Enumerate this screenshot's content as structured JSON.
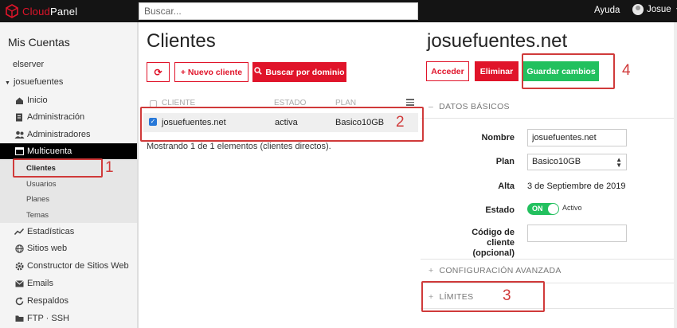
{
  "topbar": {
    "logo_cloud": "Cloud",
    "logo_panel": "Panel",
    "search_placeholder": "Buscar...",
    "help": "Ayuda",
    "user": "Josue"
  },
  "sidebar": {
    "heading": "Mis Cuentas",
    "server": "elserver",
    "account": "josuefuentes",
    "items": [
      {
        "label": "Inicio",
        "icon": "home-icon"
      },
      {
        "label": "Administración",
        "icon": "document-icon"
      },
      {
        "label": "Administradores",
        "icon": "users-icon"
      },
      {
        "label": "Multicuenta",
        "icon": "multiaccount-icon"
      },
      {
        "label": "Estadísticas",
        "icon": "chart-icon"
      },
      {
        "label": "Sitios web",
        "icon": "globe-icon"
      },
      {
        "label": "Constructor de Sitios Web",
        "icon": "gear-icon"
      },
      {
        "label": "Emails",
        "icon": "envelope-icon"
      },
      {
        "label": "Respaldos",
        "icon": "refresh-icon"
      },
      {
        "label": "FTP · SSH",
        "icon": "folder-icon"
      }
    ],
    "subitems": [
      "Clientes",
      "Usuarios",
      "Planes",
      "Temas"
    ]
  },
  "main": {
    "title": "Clientes",
    "buttons": {
      "refresh": "⟳",
      "new_client": "+ Nuevo cliente",
      "search_domain": "Buscar por dominio"
    },
    "table": {
      "headers": [
        "CLIENTE",
        "ESTADO",
        "PLAN"
      ],
      "rows": [
        {
          "client": "josuefuentes.net",
          "status": "activa",
          "plan": "Basico10GB"
        }
      ]
    },
    "showing": "Mostrando 1 de 1 elementos (clientes directos)."
  },
  "detail": {
    "title": "josuefuentes.net",
    "buttons": {
      "access": "Acceder",
      "delete": "Eliminar",
      "save": "Guardar cambios"
    },
    "sections": {
      "basic": "DATOS BÁSICOS",
      "advanced": "CONFIGURACIÓN AVANZADA",
      "limits": "LÍMITES"
    },
    "fields": {
      "name_label": "Nombre",
      "name_value": "josuefuentes.net",
      "plan_label": "Plan",
      "plan_value": "Basico10GB",
      "high_label": "Alta",
      "high_value": "3 de Septiembre de 2019",
      "state_label": "Estado",
      "state_toggle": "ON",
      "state_value": "Activo",
      "code_label_1": "Código de cliente",
      "code_label_2": "(opcional)",
      "code_value": ""
    },
    "sign_minus": "–",
    "sign_plus": "+"
  },
  "annotations": [
    "1",
    "2",
    "3",
    "4"
  ],
  "colors": {
    "accent": "#e0142a",
    "save": "#22c05e",
    "annotation": "#d03a3a",
    "topbar": "#141414"
  }
}
